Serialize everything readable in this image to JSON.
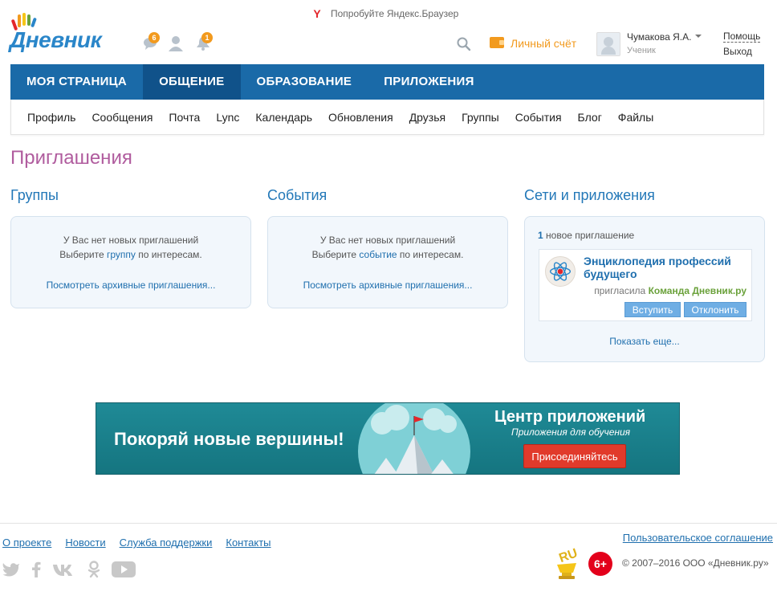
{
  "promo": {
    "text": "Попробуйте Яндекс.Браузер",
    "icon": "yandex-icon",
    "glyph": "Y"
  },
  "header": {
    "logo_text": "Дневник",
    "messages_badge": "6",
    "notifications_badge": "1",
    "account_label": "Личный счёт",
    "user_name": "Чумакова Я.А.",
    "user_role": "Ученик",
    "help_label": "Помощь",
    "logout_label": "Выход",
    "accent": "#f29a1e"
  },
  "main_nav": {
    "tabs": [
      {
        "label": "МОЯ СТРАНИЦА",
        "active": false
      },
      {
        "label": "ОБЩЕНИЕ",
        "active": true
      },
      {
        "label": "ОБРАЗОВАНИЕ",
        "active": false
      },
      {
        "label": "ПРИЛОЖЕНИЯ",
        "active": false
      }
    ],
    "color": "#1a6aa8"
  },
  "sub_nav": {
    "items": [
      "Профиль",
      "Сообщения",
      "Почта",
      "Lync",
      "Календарь",
      "Обновления",
      "Друзья",
      "Группы",
      "События",
      "Блог",
      "Файлы"
    ]
  },
  "page_title": "Приглашения",
  "groups": {
    "title": "Группы",
    "line1": "У Вас нет новых приглашений",
    "line2_prefix": "Выберите",
    "line2_link": "группу",
    "line2_suffix": "по интересам.",
    "archive": "Посмотреть архивные приглашения..."
  },
  "events": {
    "title": "События",
    "line1": "У Вас нет новых приглашений",
    "line2_prefix": "Выберите",
    "line2_link": "событие",
    "line2_suffix": "по интересам.",
    "archive": "Посмотреть архивные приглашения..."
  },
  "networks": {
    "title": "Сети и приложения",
    "count": "1",
    "count_label": "новое приглашение",
    "invite_title": "Энциклопедия профессий будущего",
    "invited_by_label": "пригласила",
    "invited_by": "Команда Дневник.ру",
    "accept": "Вступить",
    "decline": "Отклонить",
    "show_more": "Показать еще..."
  },
  "banner": {
    "slogan": "Покоряй новые вершины!",
    "title": "Центр приложений",
    "subtitle": "Приложения для обучения",
    "button": "Присоединяйтесь"
  },
  "footer": {
    "links": [
      "О проекте",
      "Новости",
      "Служба поддержки",
      "Контакты"
    ],
    "agreement": "Пользовательское соглашение",
    "age": "6+",
    "copyright": "© 2007–2016 ООО «Дневник.ру»",
    "ru_label": "RU"
  }
}
